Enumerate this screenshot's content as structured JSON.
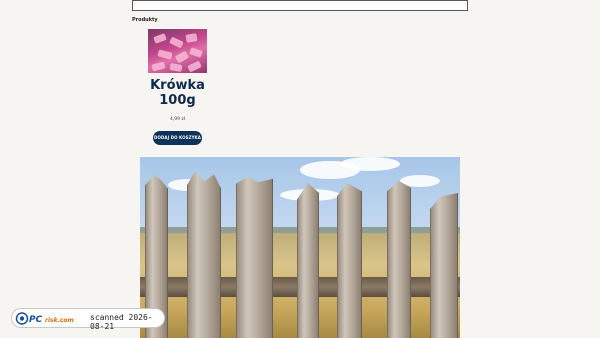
{
  "search": {
    "value": ""
  },
  "section": {
    "label": "Produkty"
  },
  "product": {
    "title": "Krówka 100g",
    "price": "4,99 zł",
    "cart_label": "DODAJ DO KOSZYKA"
  },
  "hero": {
    "image_icon": "fence-photo"
  },
  "watermark": {
    "logo_text": "PCrisk.com",
    "scanned": "scanned 2026-08-21"
  },
  "colors": {
    "accent": "#0f3258",
    "title": "#0e2a4a",
    "background": "#f7f5f2"
  }
}
